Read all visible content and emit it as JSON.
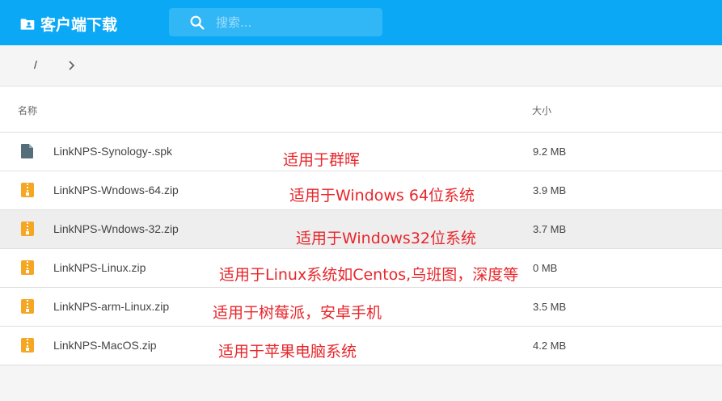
{
  "header": {
    "title": "客户端下载",
    "search_placeholder": "搜索..."
  },
  "breadcrumb": {
    "root": "/"
  },
  "columns": {
    "name": "名称",
    "size": "大小"
  },
  "files": [
    {
      "name": "LinkNPS-Synology-.spk",
      "size": "9.2 MB",
      "icon": "file-icon",
      "note": "适用于群晖"
    },
    {
      "name": "LinkNPS-Wndows-64.zip",
      "size": "3.9 MB",
      "icon": "zip-icon",
      "note": "适用于Windows 64位系统"
    },
    {
      "name": "LinkNPS-Wndows-32.zip",
      "size": "3.7 MB",
      "icon": "zip-icon",
      "note": "适用于Windows32位系统"
    },
    {
      "name": "LinkNPS-Linux.zip",
      "size": "0 MB",
      "icon": "zip-icon",
      "note": "适用于Linux系统如Centos,乌班图，深度等"
    },
    {
      "name": "LinkNPS-arm-Linux.zip",
      "size": "3.5 MB",
      "icon": "zip-icon",
      "note": "适用于树莓派，安卓手机"
    },
    {
      "name": "LinkNPS-MacOS.zip",
      "size": "4.2 MB",
      "icon": "zip-icon",
      "note": "适用于苹果电脑系统"
    }
  ],
  "colors": {
    "header_bg": "#0aa8f5",
    "zip_icon": "#f5a623",
    "file_icon": "#546e7a",
    "note_text": "#e8262b"
  }
}
